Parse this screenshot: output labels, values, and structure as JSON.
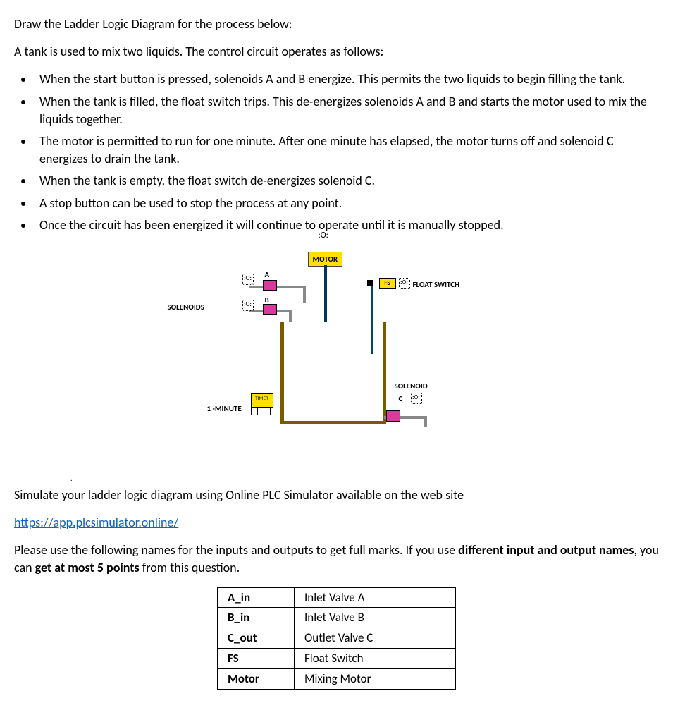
{
  "title": "Draw the Ladder Logic Diagram for the process below:",
  "intro": "A tank is used to mix two liquids. The control circuit operates as follows:",
  "bullets": [
    "When the start button is pressed, solenoids A and B  energize. This permits the two liquids to begin filling the tank.",
    "When the tank is filled, the float switch trips. This de-energizes solenoids A and B and starts the motor used to mix the liquids together.",
    "The motor is permitted to run for one minute. After one minute has elapsed, the motor turns off and solenoid C energizes to drain the tank.",
    "When the tank is empty, the float switch de-energizes solenoid C.",
    "A stop button can be used to stop the process at any point.",
    "Once the circuit has been energized it will continue to operate until it is manually stopped."
  ],
  "diagram": {
    "motor_top": ":O:",
    "motor_label": "MOTOR",
    "solenoids_label": "SOLENOIDS",
    "a_label": "A",
    "b_label": "B",
    "c_label": "C",
    "timer_text": "TIMER",
    "timer_label": "1 -MINUTE",
    "float_fs": "FS",
    "float_label": "FLOAT SWITCH",
    "solenoid_c_label": "SOLENOID",
    "symbol": ":O:"
  },
  "simulate": "Simulate your ladder logic diagram using Online PLC Simulator available on the web site",
  "url": "https://app.plcsimulator.online/",
  "names_text_a": "Please use the following names for the inputs and outputs to get full marks. If you use ",
  "names_text_bold1": "different input and output names",
  "names_text_b": ", you can ",
  "names_text_bold2": "get at most 5 points",
  "names_text_c": " from this question.",
  "names_table": [
    {
      "k": "A_in",
      "v": "Inlet Valve A"
    },
    {
      "k": "B_in",
      "v": "Inlet Valve B"
    },
    {
      "k": "C_out",
      "v": "Outlet Valve C"
    },
    {
      "k": "FS",
      "v": "Float Switch"
    },
    {
      "k": "Motor",
      "v": "Mixing Motor"
    }
  ]
}
